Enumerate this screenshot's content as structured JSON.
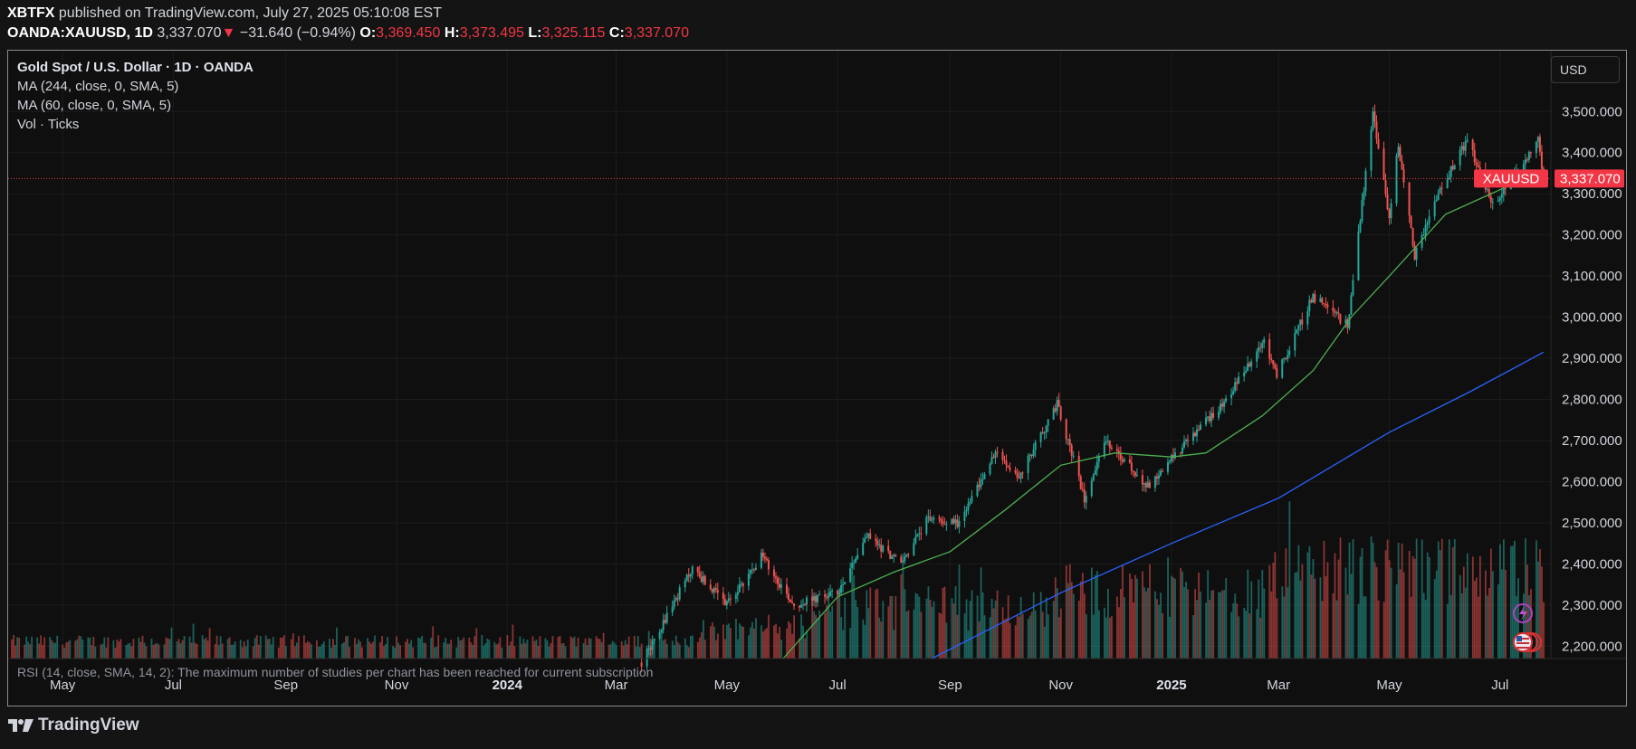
{
  "header": {
    "publisher": "XBTFX",
    "published_text": "published on TradingView.com, July 27, 2025 05:10:08 EST",
    "symbol": "OANDA:XAUUSD, 1D",
    "last": "3,337.070",
    "change_arrow": "▼",
    "change": "−31.640 (−0.94%)",
    "o_label": "O:",
    "o_value": "3,369.450",
    "h_label": "H:",
    "h_value": "3,373.495",
    "l_label": "L:",
    "l_value": "3,325.115",
    "c_label": "C:",
    "c_value": "3,337.070"
  },
  "legend": {
    "title": "Gold Spot / U.S. Dollar · 1D · OANDA",
    "ma244": "MA (244, close, 0, SMA, 5)",
    "ma60": "MA (60, close, 0, SMA, 5)",
    "vol": "Vol · Ticks"
  },
  "rsi_note": "RSI (14, close, SMA, 14, 2): The maximum number of studies per chart has been reached for current subscription",
  "currency_button": "USD",
  "brand": "TradingView",
  "colors": {
    "up": "#26a69a",
    "down": "#ef5350",
    "ma60": "#4caf50",
    "ma244": "#2962ff",
    "price_tag": "#f23645"
  },
  "chart_data": {
    "type": "candlestick",
    "title": "Gold Spot / U.S. Dollar · 1D · OANDA",
    "symbol_tag": "XAUUSD",
    "last_price": 3337.07,
    "last_price_label": "3,337.070",
    "ylim": [
      2170,
      3560
    ],
    "y_ticks": [
      2200,
      2300,
      2400,
      2500,
      2600,
      2700,
      2800,
      2900,
      3000,
      3100,
      3200,
      3300,
      3400,
      3500
    ],
    "y_tick_labels": [
      "2,200.000",
      "2,300.000",
      "2,400.000",
      "2,500.000",
      "2,600.000",
      "2,700.000",
      "2,800.000",
      "2,900.000",
      "3,000.000",
      "3,100.000",
      "3,200.000",
      "3,300.000",
      "3,400.000",
      "3,500.000"
    ],
    "x_ticks": [
      {
        "label": "May",
        "year": false
      },
      {
        "label": "Jul",
        "year": false
      },
      {
        "label": "Sep",
        "year": false
      },
      {
        "label": "Nov",
        "year": false
      },
      {
        "label": "2024",
        "year": true
      },
      {
        "label": "Mar",
        "year": false
      },
      {
        "label": "May",
        "year": false
      },
      {
        "label": "Jul",
        "year": false
      },
      {
        "label": "Sep",
        "year": false
      },
      {
        "label": "Nov",
        "year": false
      },
      {
        "label": "2025",
        "year": true
      },
      {
        "label": "Mar",
        "year": false
      },
      {
        "label": "May",
        "year": false
      },
      {
        "label": "Jul",
        "year": false
      }
    ],
    "price_path": [
      [
        "2024-03-15",
        2160
      ],
      [
        "2024-04-12",
        2390
      ],
      [
        "2024-05-01",
        2300
      ],
      [
        "2024-05-20",
        2420
      ],
      [
        "2024-06-07",
        2300
      ],
      [
        "2024-07-01",
        2330
      ],
      [
        "2024-07-17",
        2470
      ],
      [
        "2024-08-05",
        2400
      ],
      [
        "2024-08-20",
        2510
      ],
      [
        "2024-09-06",
        2500
      ],
      [
        "2024-09-26",
        2670
      ],
      [
        "2024-10-09",
        2610
      ],
      [
        "2024-10-30",
        2790
      ],
      [
        "2024-11-14",
        2560
      ],
      [
        "2024-11-25",
        2700
      ],
      [
        "2024-12-19",
        2590
      ],
      [
        "2025-01-02",
        2660
      ],
      [
        "2025-01-31",
        2800
      ],
      [
        "2025-02-21",
        2940
      ],
      [
        "2025-02-28",
        2860
      ],
      [
        "2025-03-20",
        3050
      ],
      [
        "2025-04-08",
        2980
      ],
      [
        "2025-04-22",
        3500
      ],
      [
        "2025-05-01",
        3240
      ],
      [
        "2025-05-06",
        3420
      ],
      [
        "2025-05-15",
        3150
      ],
      [
        "2025-05-28",
        3300
      ],
      [
        "2025-06-13",
        3430
      ],
      [
        "2025-06-27",
        3270
      ],
      [
        "2025-07-11",
        3360
      ],
      [
        "2025-07-22",
        3430
      ],
      [
        "2025-07-25",
        3337
      ]
    ],
    "ma60_path": [
      [
        "2024-06-01",
        2170
      ],
      [
        "2024-07-01",
        2320
      ],
      [
        "2024-08-01",
        2380
      ],
      [
        "2024-09-01",
        2430
      ],
      [
        "2024-10-01",
        2530
      ],
      [
        "2024-11-01",
        2640
      ],
      [
        "2024-12-01",
        2670
      ],
      [
        "2025-01-01",
        2660
      ],
      [
        "2025-01-20",
        2670
      ],
      [
        "2025-02-20",
        2760
      ],
      [
        "2025-03-20",
        2870
      ],
      [
        "2025-04-10",
        3000
      ],
      [
        "2025-05-01",
        3100
      ],
      [
        "2025-06-01",
        3250
      ],
      [
        "2025-07-01",
        3310
      ],
      [
        "2025-07-25",
        3360
      ]
    ],
    "ma244_path": [
      [
        "2024-08-22",
        2170
      ],
      [
        "2024-11-01",
        2330
      ],
      [
        "2025-01-01",
        2450
      ],
      [
        "2025-03-01",
        2560
      ],
      [
        "2025-05-01",
        2720
      ],
      [
        "2025-06-15",
        2820
      ],
      [
        "2025-07-25",
        2915
      ]
    ]
  }
}
